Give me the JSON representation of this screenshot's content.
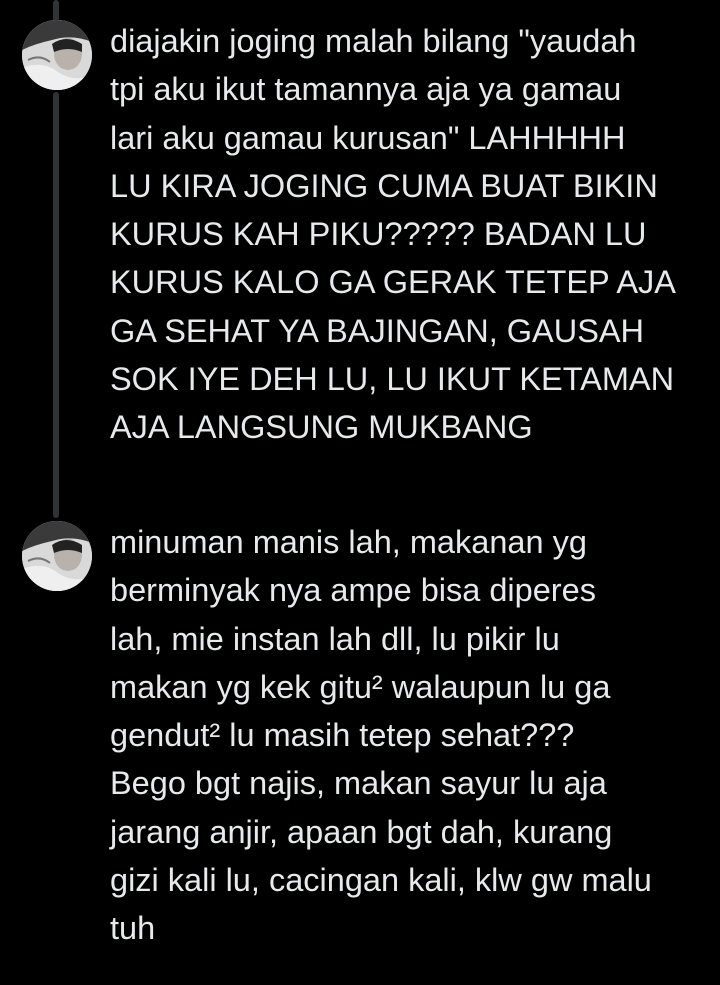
{
  "thread": {
    "posts": [
      {
        "avatar_icon": "profile-photo-avatar",
        "lines": [
          "diajakin joging malah bilang \"yaudah",
          "tpi aku ikut tamannya aja ya gamau",
          "lari aku gamau kurusan\" LAHHHHH",
          "LU KIRA JOGING CUMA BUAT BIKIN",
          "KURUS KAH PIKU????? BADAN LU",
          "KURUS KALO GA GERAK TETEP AJA",
          "GA SEHAT YA BAJINGAN, GAUSAH",
          "SOK IYE DEH LU, LU IKUT KETAMAN",
          "AJA LANGSUNG MUKBANG"
        ]
      },
      {
        "avatar_icon": "profile-photo-avatar",
        "lines": [
          "minuman manis lah, makanan yg",
          "berminyak nya ampe bisa diperes",
          "lah, mie instan lah dll, lu pikir lu",
          "makan yg kek gitu² walaupun lu ga",
          "gendut² lu masih tetep sehat???",
          "Bego bgt najis, makan sayur lu aja",
          "jarang anjir, apaan bgt dah, kurang",
          "gizi kali lu, cacingan kali, klw gw malu",
          "tuh"
        ]
      }
    ]
  },
  "colors": {
    "background": "#000000",
    "text": "#e7e9ea",
    "thread_line": "#2f3336"
  }
}
